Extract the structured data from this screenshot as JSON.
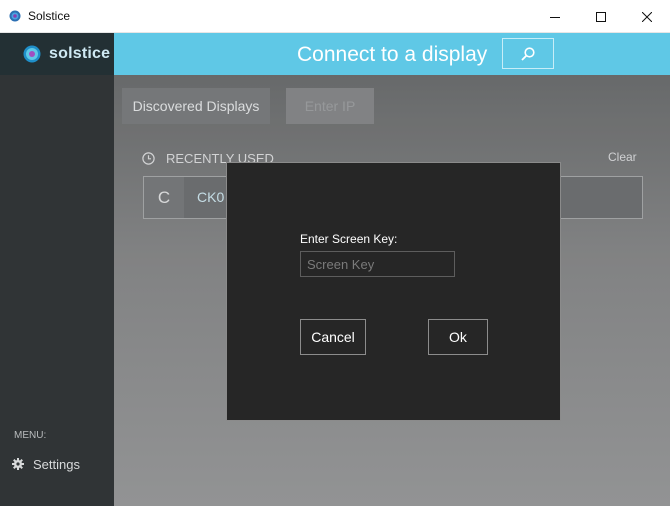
{
  "window": {
    "title": "Solstice",
    "app_icon": "solstice-logo-icon",
    "minimize_icon": "minimize-icon",
    "maximize_icon": "maximize-icon",
    "close_icon": "close-icon"
  },
  "sidebar": {
    "logo_text": "solstice",
    "logo_icon": "solstice-logo-icon",
    "menu_caption": "MENU:",
    "settings_label": "Settings",
    "settings_icon": "gear-icon"
  },
  "header": {
    "title": "Connect to a display",
    "search_icon": "search-icon"
  },
  "tabs": [
    {
      "label": "Discovered Displays",
      "active": true
    },
    {
      "label": "Enter IP",
      "active": false
    }
  ],
  "recent": {
    "heading": "RECENTLY USED",
    "heading_icon": "clock-icon",
    "clear_label": "Clear",
    "items": [
      {
        "letter": "C",
        "name": "CK0"
      }
    ]
  },
  "dialog": {
    "label": "Enter Screen Key:",
    "input_placeholder": "Screen Key",
    "input_value": "",
    "cancel_label": "Cancel",
    "ok_label": "Ok"
  },
  "colors": {
    "accent": "#5fc8e6",
    "sidebar_bg": "#303436",
    "logo_bg": "#233034",
    "dialog_bg": "#262626"
  }
}
